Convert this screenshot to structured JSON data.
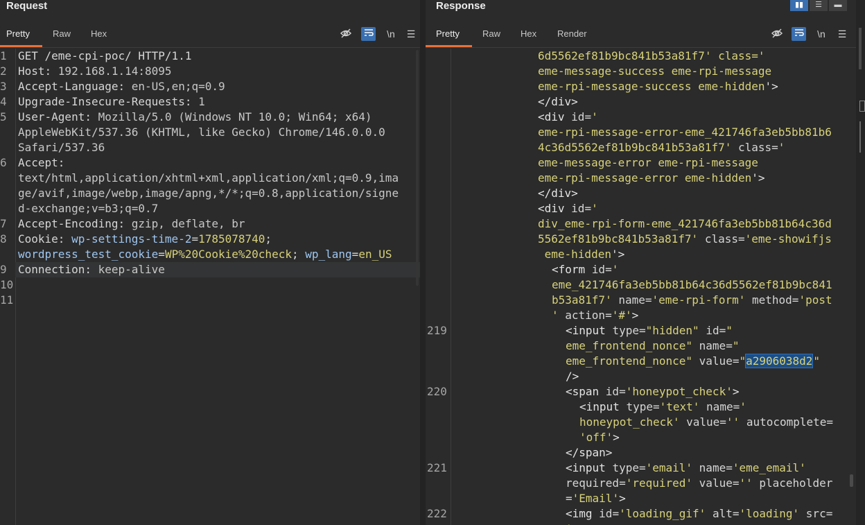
{
  "request": {
    "title": "Request",
    "tabs": [
      "Pretty",
      "Raw",
      "Hex"
    ],
    "active_tab": "Pretty",
    "icons": [
      "hide-icon",
      "wrap-icon",
      "newline-icon",
      "menu-icon"
    ],
    "newline_label": "\\n",
    "lines": [
      {
        "n": "1",
        "parts": [
          {
            "c": "k",
            "t": "GET /eme-cpi-poc/ HTTP/1.1"
          }
        ]
      },
      {
        "n": "2",
        "parts": [
          {
            "c": "k",
            "t": "Host: "
          },
          {
            "c": "v",
            "t": "192.168.1.14:8095"
          }
        ]
      },
      {
        "n": "3",
        "parts": [
          {
            "c": "k",
            "t": "Accept-Language: "
          },
          {
            "c": "v",
            "t": "en-US,en;q=0.9"
          }
        ]
      },
      {
        "n": "4",
        "parts": [
          {
            "c": "k",
            "t": "Upgrade-Insecure-Requests: "
          },
          {
            "c": "v",
            "t": "1"
          }
        ]
      },
      {
        "n": "5",
        "parts": [
          {
            "c": "k",
            "t": "User-Agent: "
          },
          {
            "c": "v",
            "t": "Mozilla/5.0 (Windows NT 10.0; Win64; x64)"
          }
        ]
      },
      {
        "n": "",
        "parts": [
          {
            "c": "v",
            "t": "AppleWebKit/537.36 (KHTML, like Gecko) Chrome/146.0.0.0"
          }
        ]
      },
      {
        "n": "",
        "parts": [
          {
            "c": "v",
            "t": "Safari/537.36"
          }
        ]
      },
      {
        "n": "6",
        "parts": [
          {
            "c": "k",
            "t": "Accept: "
          }
        ]
      },
      {
        "n": "",
        "parts": [
          {
            "c": "v",
            "t": "text/html,application/xhtml+xml,application/xml;q=0.9,ima"
          }
        ]
      },
      {
        "n": "",
        "parts": [
          {
            "c": "v",
            "t": "ge/avif,image/webp,image/apng,*/*;q=0.8,application/signe"
          }
        ]
      },
      {
        "n": "",
        "parts": [
          {
            "c": "v",
            "t": "d-exchange;v=b3;q=0.7"
          }
        ]
      },
      {
        "n": "7",
        "parts": [
          {
            "c": "k",
            "t": "Accept-Encoding: "
          },
          {
            "c": "v",
            "t": "gzip, deflate, br"
          }
        ]
      },
      {
        "n": "8",
        "parts": [
          {
            "c": "k",
            "t": "Cookie: "
          },
          {
            "c": "ck",
            "t": "wp-settings-time-2"
          },
          {
            "c": "k",
            "t": "="
          },
          {
            "c": "cv",
            "t": "1785078740"
          },
          {
            "c": "k",
            "t": ";"
          }
        ]
      },
      {
        "n": "",
        "parts": [
          {
            "c": "ck",
            "t": "wordpress_test_cookie"
          },
          {
            "c": "k",
            "t": "="
          },
          {
            "c": "cv",
            "t": "WP%20Cookie%20check"
          },
          {
            "c": "k",
            "t": "; "
          },
          {
            "c": "ck",
            "t": "wp_lang"
          },
          {
            "c": "k",
            "t": "="
          },
          {
            "c": "cv",
            "t": "en_US"
          }
        ]
      },
      {
        "n": "9",
        "hl": true,
        "parts": [
          {
            "c": "k",
            "t": "Connection: "
          },
          {
            "c": "v",
            "t": "keep-alive"
          }
        ]
      },
      {
        "n": "10",
        "parts": []
      },
      {
        "n": "11",
        "parts": []
      }
    ]
  },
  "response": {
    "title": "Response",
    "tabs": [
      "Pretty",
      "Raw",
      "Hex",
      "Render"
    ],
    "active_tab": "Pretty",
    "icons": [
      "hide-icon",
      "wrap-icon",
      "newline-icon",
      "menu-icon"
    ],
    "newline_label": "\\n",
    "lines": [
      {
        "n": "",
        "ind": 0,
        "parts": [
          {
            "c": "sv",
            "t": "6d5562ef81b9bc841b53a81f7' class='"
          }
        ]
      },
      {
        "n": "",
        "ind": 0,
        "parts": [
          {
            "c": "sv",
            "t": "eme-message-success eme-rpi-message"
          }
        ]
      },
      {
        "n": "",
        "ind": 0,
        "parts": [
          {
            "c": "sv",
            "t": "eme-rpi-message-success eme-hidden"
          },
          {
            "c": "tg",
            "t": "'>"
          }
        ]
      },
      {
        "n": "",
        "ind": 0,
        "parts": [
          {
            "c": "tg",
            "t": "</div>"
          }
        ]
      },
      {
        "n": "",
        "ind": 0,
        "parts": [
          {
            "c": "tg",
            "t": "<div "
          },
          {
            "c": "at",
            "t": "id="
          },
          {
            "c": "sv",
            "t": "'"
          }
        ]
      },
      {
        "n": "",
        "ind": 0,
        "parts": [
          {
            "c": "sv",
            "t": "eme-rpi-message-error-eme_421746fa3eb5bb81b6"
          }
        ]
      },
      {
        "n": "",
        "ind": 0,
        "parts": [
          {
            "c": "sv",
            "t": "4c36d5562ef81b9bc841b53a81f7' "
          },
          {
            "c": "at",
            "t": "class="
          },
          {
            "c": "sv",
            "t": "'"
          }
        ]
      },
      {
        "n": "",
        "ind": 0,
        "parts": [
          {
            "c": "sv",
            "t": "eme-message-error eme-rpi-message"
          }
        ]
      },
      {
        "n": "",
        "ind": 0,
        "parts": [
          {
            "c": "sv",
            "t": "eme-rpi-message-error eme-hidden"
          },
          {
            "c": "tg",
            "t": "'>"
          }
        ]
      },
      {
        "n": "",
        "ind": 0,
        "parts": [
          {
            "c": "tg",
            "t": "</div>"
          }
        ]
      },
      {
        "n": "",
        "ind": 0,
        "parts": [
          {
            "c": "tg",
            "t": "<div "
          },
          {
            "c": "at",
            "t": "id="
          },
          {
            "c": "sv",
            "t": "'"
          }
        ]
      },
      {
        "n": "",
        "ind": 0,
        "parts": [
          {
            "c": "sv",
            "t": "div_eme-rpi-form-eme_421746fa3eb5bb81b64c36d"
          }
        ]
      },
      {
        "n": "",
        "ind": 0,
        "parts": [
          {
            "c": "sv",
            "t": "5562ef81b9bc841b53a81f7' "
          },
          {
            "c": "at",
            "t": "class="
          },
          {
            "c": "sv",
            "t": "'eme-showifjs"
          }
        ]
      },
      {
        "n": "",
        "ind": 0,
        "parts": [
          {
            "c": "sv",
            "t": " eme-hidden"
          },
          {
            "c": "tg",
            "t": "'>"
          }
        ]
      },
      {
        "n": "",
        "ind": 1,
        "parts": [
          {
            "c": "tg",
            "t": "<form "
          },
          {
            "c": "at",
            "t": "id="
          },
          {
            "c": "sv",
            "t": "'"
          }
        ]
      },
      {
        "n": "",
        "ind": 1,
        "parts": [
          {
            "c": "sv",
            "t": "eme_421746fa3eb5bb81b64c36d5562ef81b9bc841"
          }
        ]
      },
      {
        "n": "",
        "ind": 1,
        "parts": [
          {
            "c": "sv",
            "t": "b53a81f7' "
          },
          {
            "c": "at",
            "t": "name="
          },
          {
            "c": "sv",
            "t": "'eme-rpi-form' "
          },
          {
            "c": "at",
            "t": "method="
          },
          {
            "c": "sv",
            "t": "'post"
          }
        ]
      },
      {
        "n": "",
        "ind": 1,
        "parts": [
          {
            "c": "sv",
            "t": "' "
          },
          {
            "c": "at",
            "t": "action="
          },
          {
            "c": "sv",
            "t": "'#'"
          },
          {
            "c": "tg",
            "t": ">"
          }
        ]
      },
      {
        "n": "219",
        "ind": 2,
        "parts": [
          {
            "c": "tg",
            "t": "<input "
          },
          {
            "c": "at",
            "t": "type="
          },
          {
            "c": "sv",
            "t": "\"hidden\" "
          },
          {
            "c": "at",
            "t": "id="
          },
          {
            "c": "sv",
            "t": "\""
          }
        ]
      },
      {
        "n": "",
        "ind": 2,
        "parts": [
          {
            "c": "sv",
            "t": "eme_frontend_nonce\" "
          },
          {
            "c": "at",
            "t": "name="
          },
          {
            "c": "sv",
            "t": "\""
          }
        ]
      },
      {
        "n": "",
        "ind": 2,
        "parts": [
          {
            "c": "sv",
            "t": "eme_frontend_nonce\" "
          },
          {
            "c": "at",
            "t": "value="
          },
          {
            "c": "sv",
            "t": "\""
          },
          {
            "c": "sel",
            "t": "a2906038d2"
          },
          {
            "c": "caret",
            "t": ""
          },
          {
            "c": "sv",
            "t": "\""
          }
        ]
      },
      {
        "n": "",
        "ind": 2,
        "parts": [
          {
            "c": "tg",
            "t": "/>"
          }
        ]
      },
      {
        "n": "220",
        "ind": 2,
        "parts": [
          {
            "c": "tg",
            "t": "<span "
          },
          {
            "c": "at",
            "t": "id="
          },
          {
            "c": "sv",
            "t": "'honeypot_check'"
          },
          {
            "c": "tg",
            "t": ">"
          }
        ]
      },
      {
        "n": "",
        "ind": 3,
        "parts": [
          {
            "c": "tg",
            "t": "<input "
          },
          {
            "c": "at",
            "t": "type="
          },
          {
            "c": "sv",
            "t": "'text' "
          },
          {
            "c": "at",
            "t": "name="
          },
          {
            "c": "sv",
            "t": "'"
          }
        ]
      },
      {
        "n": "",
        "ind": 3,
        "parts": [
          {
            "c": "sv",
            "t": "honeypot_check' "
          },
          {
            "c": "at",
            "t": "value="
          },
          {
            "c": "sv",
            "t": "'' "
          },
          {
            "c": "at",
            "t": "autocomplete="
          }
        ]
      },
      {
        "n": "",
        "ind": 3,
        "parts": [
          {
            "c": "sv",
            "t": "'off'"
          },
          {
            "c": "tg",
            "t": ">"
          }
        ]
      },
      {
        "n": "",
        "ind": 2,
        "parts": [
          {
            "c": "tg",
            "t": "</span>"
          }
        ]
      },
      {
        "n": "221",
        "ind": 2,
        "parts": [
          {
            "c": "tg",
            "t": "<input "
          },
          {
            "c": "at",
            "t": "type="
          },
          {
            "c": "sv",
            "t": "'email' "
          },
          {
            "c": "at",
            "t": "name="
          },
          {
            "c": "sv",
            "t": "'eme_email'"
          }
        ]
      },
      {
        "n": "",
        "ind": 2,
        "parts": [
          {
            "c": "at",
            "t": "required="
          },
          {
            "c": "sv",
            "t": "'required' "
          },
          {
            "c": "at",
            "t": "value="
          },
          {
            "c": "sv",
            "t": "'' "
          },
          {
            "c": "at",
            "t": "placeholder"
          }
        ]
      },
      {
        "n": "",
        "ind": 2,
        "parts": [
          {
            "c": "at",
            "t": "="
          },
          {
            "c": "sv",
            "t": "'Email'"
          },
          {
            "c": "tg",
            "t": ">"
          }
        ]
      },
      {
        "n": "222",
        "ind": 2,
        "parts": [
          {
            "c": "tg",
            "t": "<img "
          },
          {
            "c": "at",
            "t": "id="
          },
          {
            "c": "sv",
            "t": "'loading_gif' "
          },
          {
            "c": "at",
            "t": "alt="
          },
          {
            "c": "sv",
            "t": "'loading' "
          },
          {
            "c": "at",
            "t": "src="
          }
        ]
      },
      {
        "n": "",
        "ind": 2,
        "parts": [
          {
            "c": "sv",
            "t": "'"
          }
        ]
      }
    ]
  },
  "colors": {
    "accent": "#e8703a",
    "button_blue": "#3a6fb0",
    "background": "#2b2b2b"
  }
}
